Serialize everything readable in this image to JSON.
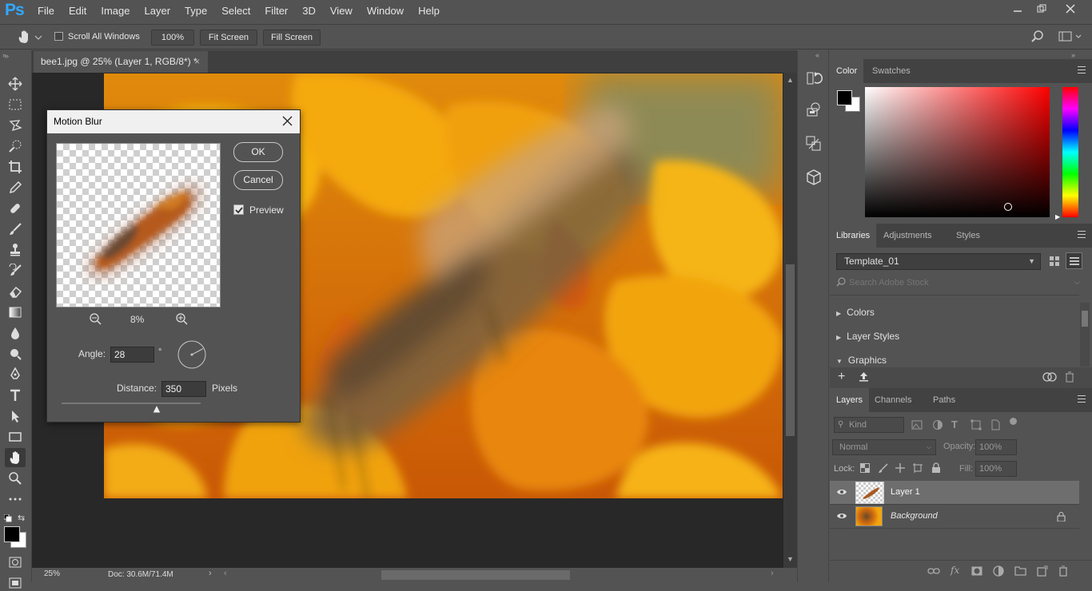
{
  "app": {
    "logo": "Ps"
  },
  "menu": [
    "File",
    "Edit",
    "Image",
    "Layer",
    "Type",
    "Select",
    "Filter",
    "3D",
    "View",
    "Window",
    "Help"
  ],
  "options": {
    "scroll_all": "Scroll All Windows",
    "zoom": "100%",
    "fit_screen": "Fit Screen",
    "fill_screen": "Fill Screen"
  },
  "document": {
    "tab_title": "bee1.jpg @ 25% (Layer 1, RGB/8*) *",
    "close": "×"
  },
  "status": {
    "zoom": "25%",
    "doc": "Doc: 30.6M/71.4M"
  },
  "dialog": {
    "title": "Motion Blur",
    "ok": "OK",
    "cancel": "Cancel",
    "preview_label": "Preview",
    "preview_checked": true,
    "zoom_pct": "8%",
    "angle_label": "Angle:",
    "angle_value": "28",
    "degree": "°",
    "distance_label": "Distance:",
    "distance_value": "350",
    "distance_unit": "Pixels"
  },
  "color_panel": {
    "tabs": [
      "Color",
      "Swatches"
    ],
    "fg": "#000000",
    "bg": "#ffffff"
  },
  "libraries_panel": {
    "tabs": [
      "Libraries",
      "Adjustments",
      "Styles"
    ],
    "library": "Template_01",
    "search_placeholder": "Search Adobe Stock",
    "sections": [
      "Colors",
      "Layer Styles",
      "Graphics"
    ]
  },
  "layers_panel": {
    "tabs": [
      "Layers",
      "Channels",
      "Paths"
    ],
    "kind": "Kind",
    "blend": "Normal",
    "opacity_label": "Opacity:",
    "opacity": "100%",
    "lock_label": "Lock:",
    "fill_label": "Fill:",
    "fill": "100%",
    "layers": [
      {
        "name": "Layer 1",
        "selected": true
      },
      {
        "name": "Background",
        "locked": true
      }
    ]
  }
}
